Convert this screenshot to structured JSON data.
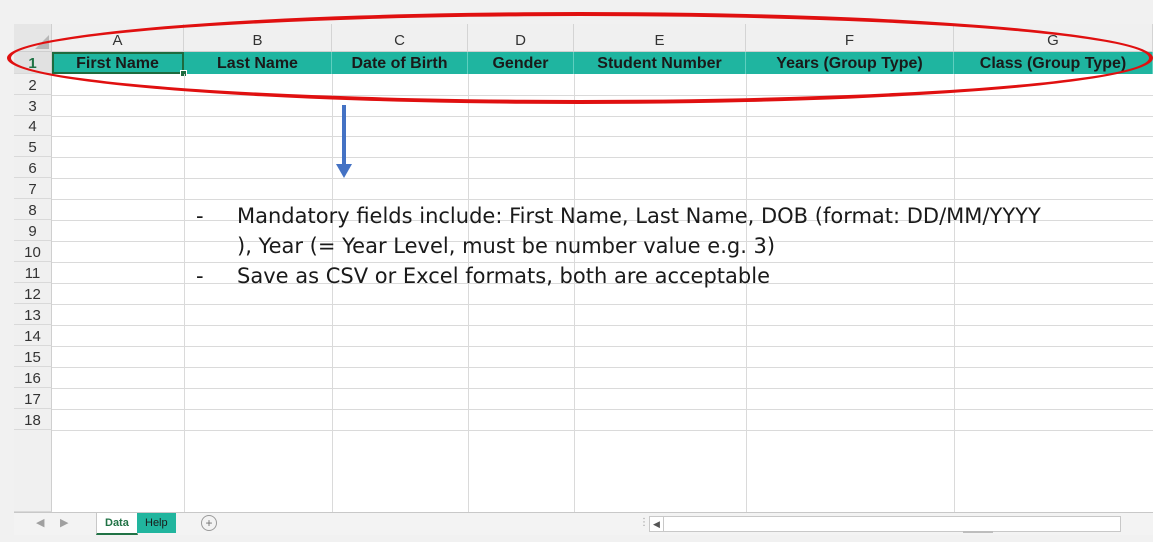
{
  "columns": [
    {
      "letter": "A",
      "header": "First Name"
    },
    {
      "letter": "B",
      "header": "Last Name"
    },
    {
      "letter": "C",
      "header": "Date of Birth"
    },
    {
      "letter": "D",
      "header": "Gender"
    },
    {
      "letter": "E",
      "header": "Student Number"
    },
    {
      "letter": "F",
      "header": "Years (Group Type)"
    },
    {
      "letter": "G",
      "header": "Class (Group Type)"
    }
  ],
  "rows": [
    "1",
    "2",
    "3",
    "4",
    "5",
    "6",
    "7",
    "8",
    "9",
    "10",
    "11",
    "12",
    "13",
    "14",
    "15",
    "16",
    "17",
    "18"
  ],
  "note": {
    "items": [
      "Mandatory fields include: First Name, Last Name, DOB (format: DD/MM/YYYY ), Year (= Year Level, must be number value e.g. 3)",
      "Save as CSV or Excel formats, both are acceptable"
    ],
    "dash": "-"
  },
  "sheet_tabs": {
    "data": "Data",
    "help": "Help"
  },
  "icons": {
    "add_sheet": "plus-circle-icon",
    "scroll_left": "triangle-left-icon",
    "nav_prev": "chevron-left-icon",
    "nav_next": "chevron-right-icon"
  },
  "colors": {
    "header_fill": "#1fb5a0",
    "highlight_oval": "#e01010",
    "arrow": "#4472c4",
    "excel_green": "#217346"
  }
}
